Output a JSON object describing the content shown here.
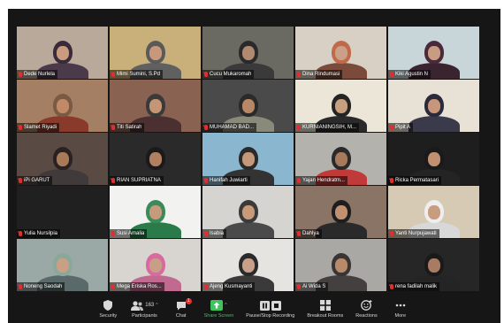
{
  "participants": [
    {
      "name": "Dede Nurlela",
      "bg": "#b9a99a",
      "skin": "#c99b7f",
      "hijab": "#3a2a3a",
      "top": "#4a3a4a"
    },
    {
      "name": "Mimi Sumini, S.Pd",
      "bg": "#c9b07a",
      "skin": "#c7987a",
      "hijab": "#5a5a5a",
      "top": "#606060"
    },
    {
      "name": "Cucu Mukaromah",
      "bg": "#6a6a62",
      "skin": "#b08a70",
      "hijab": "#2a2a2a",
      "top": "#3a3a3a"
    },
    {
      "name": "Dina Rindumasi",
      "bg": "#d8d0c4",
      "skin": "#caa088",
      "hijab": "#c06a4a",
      "top": "#7a4a3a"
    },
    {
      "name": "Kiki Agustin N",
      "bg": "#c8d6da",
      "skin": "#c89c80",
      "hijab": "#4a2a3a",
      "top": "#3a2430"
    },
    {
      "name": "Slamet Riyadi",
      "bg": "#a57f64",
      "skin": "#c08a66",
      "hijab": "#7a5a42",
      "top": "#8a3a2a"
    },
    {
      "name": "Titi Satirah",
      "bg": "#8a6252",
      "skin": "#c49676",
      "hijab": "#3a3a3a",
      "top": "#4a3030"
    },
    {
      "name": "MUHAMAD BAD...",
      "bg": "#4a4a4a",
      "skin": "#b88866",
      "hijab": "#2a2a2a",
      "top": "#8a8a7a"
    },
    {
      "name": "KURNIANINGSIH, M...",
      "bg": "#ece6d8",
      "skin": "#c8a080",
      "hijab": "#242424",
      "top": "#2a2a2a"
    },
    {
      "name": "Pipit A",
      "bg": "#e8e2d6",
      "skin": "#c8967a",
      "hijab": "#2a2a3a",
      "top": "#3a3a4a"
    },
    {
      "name": "iPi GARUT",
      "bg": "#5a4a44",
      "skin": "#a87a5a",
      "hijab": "#2a2222",
      "top": "#403a3a"
    },
    {
      "name": "RIAN SUPRIATNA",
      "bg": "#2a2a2a",
      "skin": "#b08060",
      "hijab": "#1a1a1a",
      "top": "#2a2a2a"
    },
    {
      "name": "Hanifah Juwiarti",
      "bg": "#8ab6d0",
      "skin": "#c49878",
      "hijab": "#2a2a2a",
      "top": "#333333"
    },
    {
      "name": "Yajan Hendratm...",
      "bg": "#b4b2ac",
      "skin": "#a87a5c",
      "hijab": "#2a2a2a",
      "top": "#c03a3a"
    },
    {
      "name": "Ricka Permatasari",
      "bg": "#1e1e1e",
      "skin": "#c09070",
      "hijab": "#1a1a1a",
      "top": "#242424"
    },
    {
      "name": "Yulia Nursilpia",
      "bg": "#202020",
      "skin": "#202020",
      "hijab": "#202020",
      "top": "#202020"
    },
    {
      "name": "Susi Amalia",
      "bg": "#f2f2f0",
      "skin": "#c89a7c",
      "hijab": "#3a8a5a",
      "top": "#2a7a4a"
    },
    {
      "name": "Isabia",
      "bg": "#d6d4d0",
      "skin": "#c89a7a",
      "hijab": "#3a3a3a",
      "top": "#4a4a4a"
    },
    {
      "name": "Dahlya",
      "bg": "#8a7466",
      "skin": "#c09070",
      "hijab": "#1e1e1e",
      "top": "#2a2a2a"
    },
    {
      "name": "Yanti Nurpujawati",
      "bg": "#d6cab4",
      "skin": "#c89c7e",
      "hijab": "#eeeeee",
      "top": "#d8d8d8"
    },
    {
      "name": "Noneng Saodah",
      "bg": "#9aa8a6",
      "skin": "#caa084",
      "hijab": "#8aa89a",
      "top": "#5a6a6a"
    },
    {
      "name": "Mega Eriska Ros...",
      "bg": "#d8d4d0",
      "skin": "#c89e86",
      "hijab": "#d86aa0",
      "top": "#c06a90"
    },
    {
      "name": "Ajeng Kusmayanti",
      "bg": "#e6e4e0",
      "skin": "#c8a08a",
      "hijab": "#2a2a2a",
      "top": "#3a3a3a"
    },
    {
      "name": "Ai Wida S",
      "bg": "#aaa8a4",
      "skin": "#b88a6c",
      "hijab": "#3a3434",
      "top": "#444040"
    },
    {
      "name": "rena fadilah malik",
      "bg": "#262626",
      "skin": "#a87c62",
      "hijab": "#1a1a1a",
      "top": "#242424"
    }
  ],
  "toolbar": [
    {
      "label": "Security",
      "icon": "shield-icon"
    },
    {
      "label": "Participants",
      "icon": "participants-icon",
      "count": "163"
    },
    {
      "label": "Chat",
      "icon": "chat-icon",
      "badge": "1"
    },
    {
      "label": "Share Screen",
      "icon": "share-screen-icon",
      "color": "#3ec45a"
    },
    {
      "label": "Pause/Stop Recording",
      "icon": "recording-icon"
    },
    {
      "label": "Breakout Rooms",
      "icon": "breakout-rooms-icon"
    },
    {
      "label": "Reactions",
      "icon": "reactions-icon"
    },
    {
      "label": "More",
      "icon": "more-icon"
    }
  ]
}
